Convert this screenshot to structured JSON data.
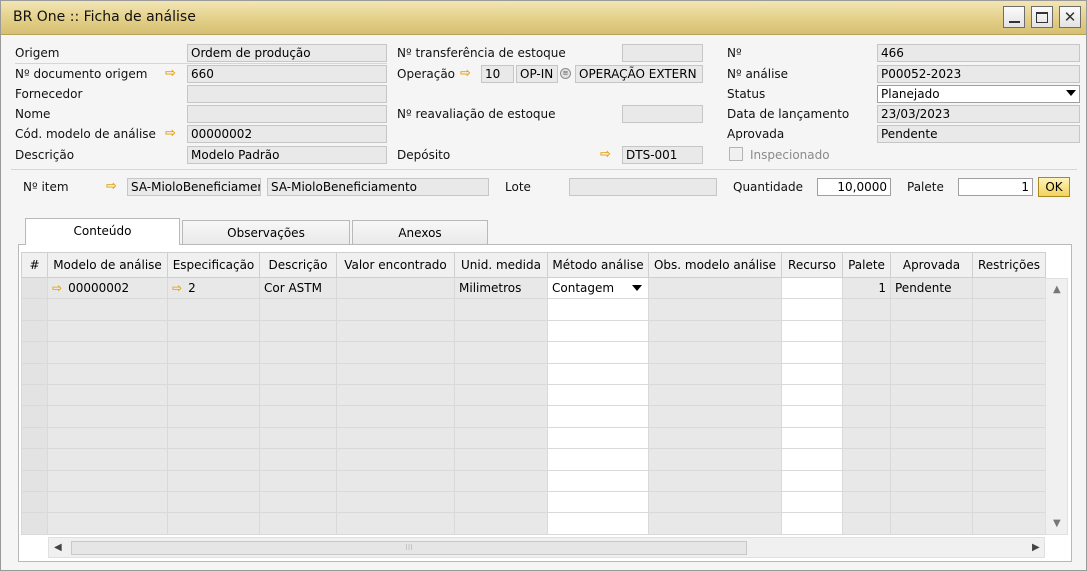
{
  "window": {
    "title": "BR One :: Ficha de análise",
    "controls": {
      "minimize_icon": "minimize-icon",
      "maximize_icon": "maximize-icon",
      "close_icon": "close-icon"
    }
  },
  "header": {
    "origem_label": "Origem",
    "origem_value": "Ordem de produção",
    "doc_origem_label": "Nº documento origem",
    "doc_origem_value": "660",
    "fornecedor_label": "Fornecedor",
    "fornecedor_value": "",
    "nome_label": "Nome",
    "nome_value": "",
    "cod_modelo_label": "Cód. modelo de análise",
    "cod_modelo_value": "00000002",
    "descricao_label": "Descrição",
    "descricao_value": "Modelo Padrão",
    "transf_estoque_label": "Nº transferência de estoque",
    "transf_estoque_value": "",
    "operacao_label": "Operação",
    "operacao_num": "10",
    "operacao_code": "OP-IN",
    "operacao_name": "OPERAÇÃO EXTERN",
    "reaval_label": "Nº reavaliação de estoque",
    "reaval_value": "",
    "deposito_label": "Depósito",
    "deposito_value": "DTS-001",
    "numero_label": "Nº",
    "numero_value": "466",
    "analise_label": "Nº análise",
    "analise_value": "P00052-2023",
    "status_label": "Status",
    "status_value": "Planejado",
    "data_label": "Data de lançamento",
    "data_value": "23/03/2023",
    "aprovada_label": "Aprovada",
    "aprovada_value": "Pendente",
    "inspecionado_label": "Inspecionado"
  },
  "item_bar": {
    "item_label": "Nº item",
    "item_code": "SA-MioloBeneficiamer",
    "item_name": "SA-MioloBeneficiamento",
    "lote_label": "Lote",
    "lote_value": "",
    "quantidade_label": "Quantidade",
    "quantidade_value": "10,0000",
    "palete_label": "Palete",
    "palete_value": "1",
    "ok_label": "OK"
  },
  "tabs": [
    {
      "label": "Conteúdo"
    },
    {
      "label": "Observações"
    },
    {
      "label": "Anexos"
    }
  ],
  "grid": {
    "columns": [
      "#",
      "Modelo de análise",
      "Especificação",
      "Descrição",
      "Valor encontrado",
      "Unid. medida",
      "Método análise",
      "Obs. modelo análise",
      "Recurso",
      "Palete",
      "Aprovada",
      "Restrições"
    ],
    "rows": [
      {
        "num": "",
        "modelo": "00000002",
        "especificacao": "2",
        "descricao": "Cor ASTM",
        "valor": "",
        "unidade": "Milimetros",
        "metodo": "Contagem",
        "obs": "",
        "recurso": "",
        "palete": "1",
        "aprovada": "Pendente",
        "restricoes": ""
      }
    ]
  },
  "colors": {
    "title_bar": "#e3cf87",
    "link_arrow": "#e3a20c",
    "ok_button": "#f2d35f"
  }
}
